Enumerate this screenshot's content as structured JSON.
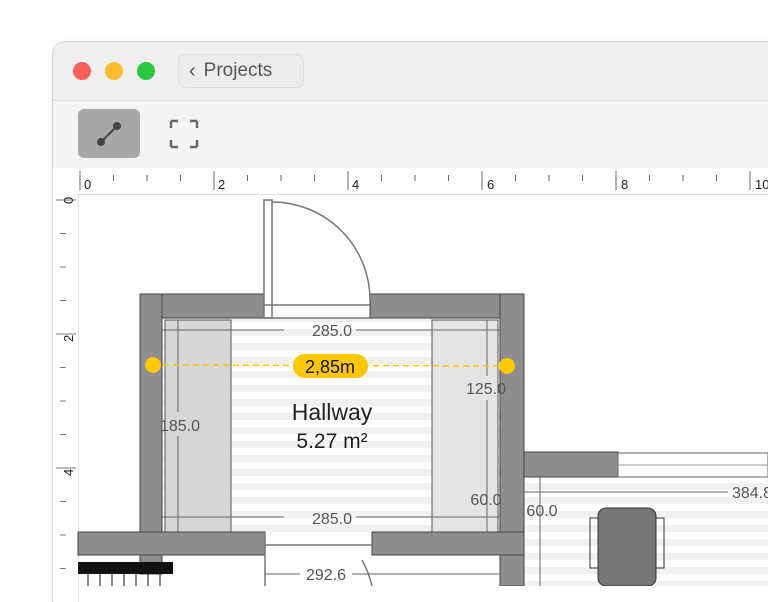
{
  "window": {
    "traffic_lights": {
      "close": "#fe5f57",
      "minimize": "#febc2e",
      "zoom": "#28c840"
    },
    "back_button": {
      "label": "Projects",
      "icon": "chevron-left-icon"
    }
  },
  "toolbar": {
    "tools": [
      {
        "name": "measure-line-tool",
        "icon": "line-measure-icon",
        "active": true
      },
      {
        "name": "select-area-tool",
        "icon": "selection-frame-icon",
        "active": false
      }
    ]
  },
  "rulers": {
    "horizontal_labels": [
      "0",
      "2",
      "4",
      "6",
      "8",
      "10"
    ],
    "vertical_labels": [
      "0",
      "2",
      "4"
    ]
  },
  "plan": {
    "room": {
      "name": "Hallway",
      "area": "5.27 m²"
    },
    "measurement": {
      "label": "2,85m",
      "color": "#ffc700"
    },
    "dimensions": {
      "top_width": "285.0",
      "bottom_width": "285.0",
      "left_height": "185.0",
      "right_upper": "125.0",
      "right_lower": "60.0",
      "adjacent_left": "60.0",
      "adjacent_width": "384.8",
      "below_width": "292.6"
    }
  }
}
